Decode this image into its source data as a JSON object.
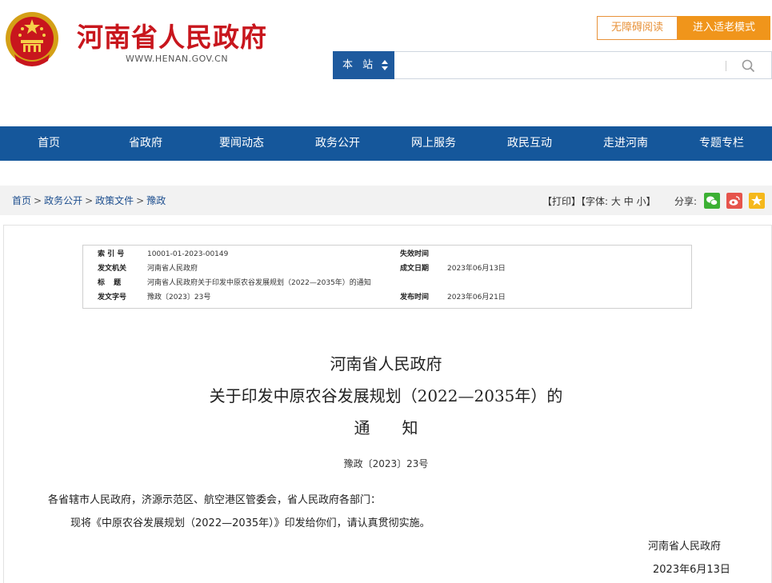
{
  "header": {
    "site_title": "河南省人民政府",
    "site_url": "WWW.HENAN.GOV.CN",
    "accessibility_label": "无障碍阅读",
    "elder_mode_label": "进入适老模式",
    "search_scope": "本 站",
    "search_placeholder": ""
  },
  "nav": {
    "items": [
      "首页",
      "省政府",
      "要闻动态",
      "政务公开",
      "网上服务",
      "政民互动",
      "走进河南",
      "专题专栏"
    ]
  },
  "breadcrumb": {
    "items": [
      "首页",
      "政务公开",
      "政策文件",
      "豫政"
    ],
    "separator": ">"
  },
  "tools": {
    "print": "【打印】",
    "font_prefix": "【字体:",
    "font_large": "大",
    "font_medium": "中",
    "font_small": "小",
    "font_suffix": "】",
    "share_label": "分享:"
  },
  "meta": {
    "index_label": "索 引 号",
    "index_value": "10001-01-2023-00149",
    "expire_label": "失效时间",
    "expire_value": "",
    "issuer_label": "发文机关",
    "issuer_value": "河南省人民政府",
    "date_label": "成文日期",
    "date_value": "2023年06月13日",
    "title_label": "标 题",
    "title_value": "河南省人民政府关于印发中原农谷发展规划（2022—2035年）的通知",
    "docno_label": "发文字号",
    "docno_value": "豫政〔2023〕23号",
    "publish_label": "发布时间",
    "publish_value": "2023年06月21日"
  },
  "document": {
    "title_line1": "河南省人民政府",
    "title_line2": "关于印发中原农谷发展规划（2022—2035年）的",
    "title_line3": "通　　知",
    "doc_number": "豫政〔2023〕23号",
    "recipients": "各省辖市人民政府，济源示范区、航空港区管委会，省人民政府各部门：",
    "body": "现将《中原农谷发展规划（2022—2035年）》印发给你们，请认真贯彻实施。",
    "signature": "河南省人民政府",
    "sign_date": "2023年6月13日"
  },
  "colors": {
    "brand_red": "#c8161d",
    "nav_blue": "#15579b",
    "accent_orange": "#f0951b"
  }
}
